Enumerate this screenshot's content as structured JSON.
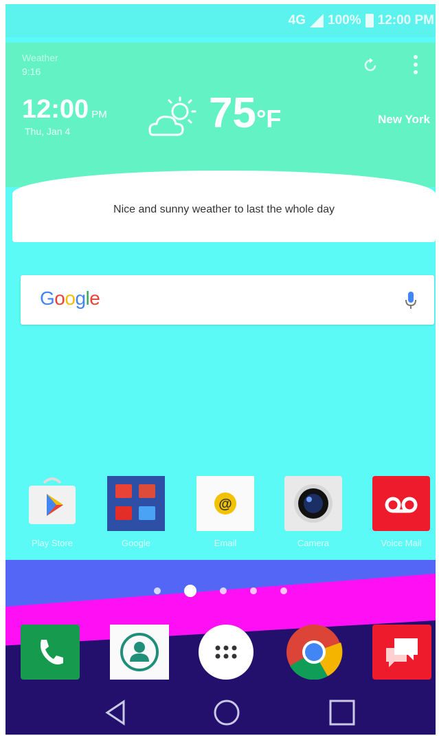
{
  "status_bar": {
    "network": "4G",
    "battery": "100%",
    "time": "12:00 PM"
  },
  "weather_widget": {
    "subtitle_1": "Weather",
    "subtitle_2": "9:16",
    "time": "12:00",
    "ampm": "PM",
    "date": "Thu, Jan 4",
    "temperature": "75",
    "unit": "°F",
    "location": "New York",
    "message": "Nice and sunny weather to last the whole day",
    "icons": [
      "partly-sunny-icon",
      "refresh-icon",
      "more-vert-icon"
    ]
  },
  "search": {
    "logo": "Google",
    "logo_colors": [
      "#4285F4",
      "#EA4335",
      "#FBBC05",
      "#4285F4",
      "#34A853",
      "#EA4335"
    ],
    "mic_icon": "mic-icon"
  },
  "apps": [
    {
      "label": "Play Store",
      "icon": "play-store-icon"
    },
    {
      "label": "Google",
      "icon": "google-folder-icon"
    },
    {
      "label": "Email",
      "icon": "email-icon"
    },
    {
      "label": "Camera",
      "icon": "camera-icon"
    },
    {
      "label": "Voice Mail",
      "icon": "voicemail-icon"
    }
  ],
  "page_indicator": {
    "pages": 5,
    "active_page": 2
  },
  "dock": [
    {
      "label": "Phone",
      "icon": "phone-icon"
    },
    {
      "label": "Contacts",
      "icon": "contacts-icon"
    },
    {
      "label": "Apps",
      "icon": "app-drawer-icon"
    },
    {
      "label": "Chrome",
      "icon": "chrome-icon"
    },
    {
      "label": "Messaging",
      "icon": "messaging-icon"
    }
  ],
  "nav": [
    {
      "name": "back",
      "icon": "back-icon"
    },
    {
      "name": "home",
      "icon": "home-icon"
    },
    {
      "name": "recents",
      "icon": "recents-icon"
    }
  ],
  "colors": {
    "wallpaper": "#5cfaf6",
    "widget": "#63f2c4",
    "band_blue": "#5466f6",
    "band_magenta": "#ff10f4",
    "dock": "#23106c"
  }
}
